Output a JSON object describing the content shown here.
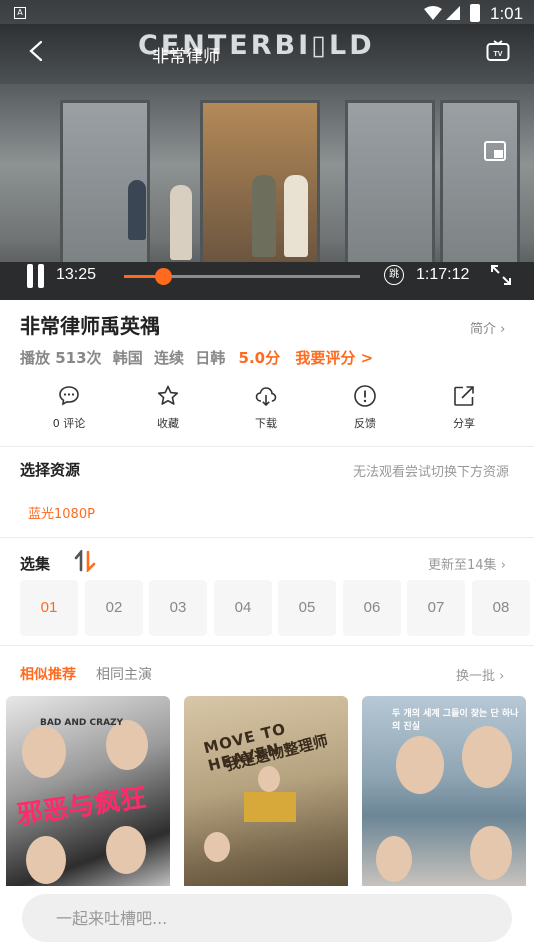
{
  "status_bar": {
    "time": "1:01",
    "notification_letter": "A"
  },
  "player": {
    "title": "非常律师",
    "building_sign": "CENTERBI▯LD",
    "current_time": "13:25",
    "total_time": "1:17:12",
    "progress_fraction": 0.17,
    "skip_label": "跳"
  },
  "show": {
    "title": "非常律师禹英禑",
    "intro_label": "简介",
    "plays": "播放 513次",
    "region": "韩国",
    "status": "连续",
    "genre": "日韩",
    "score": "5.0分",
    "rate_label": "我要评分 >"
  },
  "actions": [
    {
      "name": "comment",
      "icon": "comment-icon",
      "label": "0 评论"
    },
    {
      "name": "favorite",
      "icon": "star-icon",
      "label": "收藏"
    },
    {
      "name": "download",
      "icon": "cloud-download-icon",
      "label": "下载"
    },
    {
      "name": "feedback",
      "icon": "alert-circle-icon",
      "label": "反馈"
    },
    {
      "name": "share",
      "icon": "share-icon",
      "label": "分享"
    }
  ],
  "source": {
    "title": "选择资源",
    "hint": "无法观看尝试切换下方资源",
    "selected": "蓝光1080P"
  },
  "episodes": {
    "title": "选集",
    "update_label": "更新至14集",
    "items": [
      "01",
      "02",
      "03",
      "04",
      "05",
      "06",
      "07",
      "08"
    ],
    "active_index": 0
  },
  "recommend": {
    "tabs": [
      "相似推荐",
      "相同主演"
    ],
    "active_tab": 0,
    "refresh_label": "换一批",
    "posters": [
      {
        "text_main": "邪恶与疯狂",
        "text_small": "BAD AND CRAZY"
      },
      {
        "text_main": "MOVE TO HEAVEN",
        "text_small": "我是遗物整理师"
      },
      {
        "text_main": "",
        "text_small": "두 개의 세계 그들이 찾는 단 하나의 진실"
      }
    ]
  },
  "comment": {
    "placeholder": "一起来吐槽吧..."
  },
  "colors": {
    "accent": "#ff6a1f",
    "muted": "#888888",
    "episode_bg": "#f6f6f6"
  }
}
